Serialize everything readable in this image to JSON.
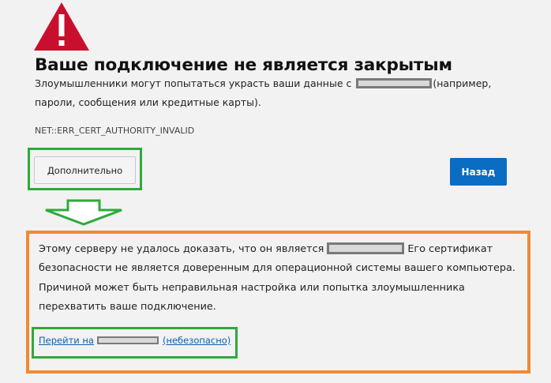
{
  "page": {
    "title": "Ваше подключение не является закрытым",
    "description_part1": "Злоумышленники могут попытаться украсть ваши данные с ",
    "description_part2": "(например, пароли, сообщения или кредитные карты).",
    "error_code": "NET::ERR_CERT_AUTHORITY_INVALID"
  },
  "buttons": {
    "advanced_label": "Дополнительно",
    "back_label": "Назад"
  },
  "details": {
    "text_part1": "Этому серверу не удалось доказать, что он является",
    "text_part2": "Его сертификат безопасности не является доверенным для операционной системы вашего компьютера. Причиной может быть неправильная настройка или попытка злоумышленника перехватить ваше подключение.",
    "proceed_prefix": "Перейти на",
    "proceed_suffix": "(небезопасно)"
  },
  "colors": {
    "warning_icon": "#c8102e",
    "primary_button": "#0a6cc2",
    "link": "#0a5fb0",
    "annotation_green": "#2eaa3a",
    "annotation_orange": "#f08a32",
    "redaction_border": "#7a7a7a"
  },
  "icons": {
    "warning": "warning-triangle-icon",
    "annotation_arrow": "down-arrow-icon"
  }
}
